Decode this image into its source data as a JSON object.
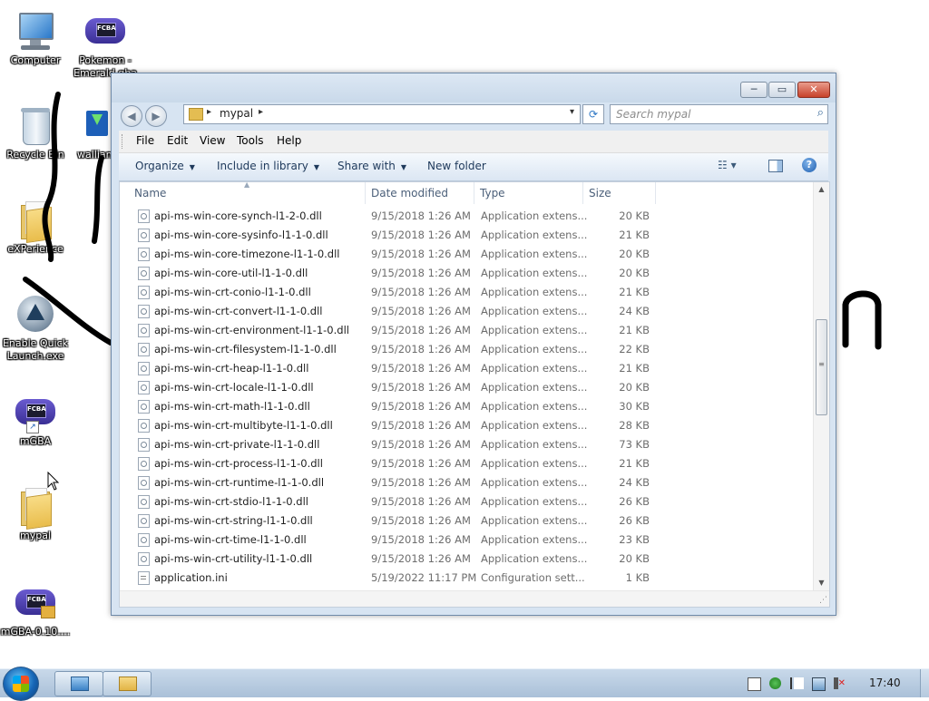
{
  "desktop": {
    "icons": [
      {
        "label": "Computer",
        "icon": "computer-icon"
      },
      {
        "label": "Pokemon - Emerald.gba",
        "icon": "gba-icon"
      },
      {
        "label": "Recycle Bin",
        "icon": "recycle-bin-icon"
      },
      {
        "label": "wallian",
        "icon": "installer-icon"
      },
      {
        "label": "eXPerience",
        "icon": "folder-icon"
      },
      {
        "label": "Enable Quick Launch.exe",
        "icon": "quick-launch-icon"
      },
      {
        "label": "mGBA",
        "icon": "gba-icon"
      },
      {
        "label": "mypal",
        "icon": "folder-icon"
      },
      {
        "label": "mGBA-0.10....",
        "icon": "gba-icon"
      }
    ],
    "gba_badge": "FCBA"
  },
  "window": {
    "controls": {
      "minimize": "─",
      "maximize": "▭",
      "close": "✕"
    },
    "nav": {
      "back": "◀",
      "forward": "▶"
    },
    "address": {
      "breadcrumb": "mypal",
      "separator": "▸",
      "dropdown": "▾"
    },
    "refresh_glyph": "⟳",
    "search": {
      "placeholder": "Search mypal",
      "glyph": "⌕"
    },
    "menu": [
      "File",
      "Edit",
      "View",
      "Tools",
      "Help"
    ],
    "commands": {
      "organize": "Organize",
      "include_in_library": "Include in library",
      "share_with": "Share with",
      "new_folder": "New folder",
      "dropdown_arrow": "▼",
      "views_glyph": "☷ ▾",
      "help_glyph": "?"
    },
    "columns": {
      "name": "Name",
      "date": "Date modified",
      "type": "Type",
      "size": "Size",
      "sort_glyph": "▲"
    },
    "scroll": {
      "up": "▲",
      "down": "▼",
      "grip": "≡"
    },
    "resize_glyph": "⋰",
    "files": [
      {
        "name": "api-ms-win-core-synch-l1-2-0.dll",
        "date": "9/15/2018 1:26 AM",
        "type": "Application extens...",
        "size": "20 KB",
        "kind": "dll"
      },
      {
        "name": "api-ms-win-core-sysinfo-l1-1-0.dll",
        "date": "9/15/2018 1:26 AM",
        "type": "Application extens...",
        "size": "21 KB",
        "kind": "dll"
      },
      {
        "name": "api-ms-win-core-timezone-l1-1-0.dll",
        "date": "9/15/2018 1:26 AM",
        "type": "Application extens...",
        "size": "20 KB",
        "kind": "dll"
      },
      {
        "name": "api-ms-win-core-util-l1-1-0.dll",
        "date": "9/15/2018 1:26 AM",
        "type": "Application extens...",
        "size": "20 KB",
        "kind": "dll"
      },
      {
        "name": "api-ms-win-crt-conio-l1-1-0.dll",
        "date": "9/15/2018 1:26 AM",
        "type": "Application extens...",
        "size": "21 KB",
        "kind": "dll"
      },
      {
        "name": "api-ms-win-crt-convert-l1-1-0.dll",
        "date": "9/15/2018 1:26 AM",
        "type": "Application extens...",
        "size": "24 KB",
        "kind": "dll"
      },
      {
        "name": "api-ms-win-crt-environment-l1-1-0.dll",
        "date": "9/15/2018 1:26 AM",
        "type": "Application extens...",
        "size": "21 KB",
        "kind": "dll"
      },
      {
        "name": "api-ms-win-crt-filesystem-l1-1-0.dll",
        "date": "9/15/2018 1:26 AM",
        "type": "Application extens...",
        "size": "22 KB",
        "kind": "dll"
      },
      {
        "name": "api-ms-win-crt-heap-l1-1-0.dll",
        "date": "9/15/2018 1:26 AM",
        "type": "Application extens...",
        "size": "21 KB",
        "kind": "dll"
      },
      {
        "name": "api-ms-win-crt-locale-l1-1-0.dll",
        "date": "9/15/2018 1:26 AM",
        "type": "Application extens...",
        "size": "20 KB",
        "kind": "dll"
      },
      {
        "name": "api-ms-win-crt-math-l1-1-0.dll",
        "date": "9/15/2018 1:26 AM",
        "type": "Application extens...",
        "size": "30 KB",
        "kind": "dll"
      },
      {
        "name": "api-ms-win-crt-multibyte-l1-1-0.dll",
        "date": "9/15/2018 1:26 AM",
        "type": "Application extens...",
        "size": "28 KB",
        "kind": "dll"
      },
      {
        "name": "api-ms-win-crt-private-l1-1-0.dll",
        "date": "9/15/2018 1:26 AM",
        "type": "Application extens...",
        "size": "73 KB",
        "kind": "dll"
      },
      {
        "name": "api-ms-win-crt-process-l1-1-0.dll",
        "date": "9/15/2018 1:26 AM",
        "type": "Application extens...",
        "size": "21 KB",
        "kind": "dll"
      },
      {
        "name": "api-ms-win-crt-runtime-l1-1-0.dll",
        "date": "9/15/2018 1:26 AM",
        "type": "Application extens...",
        "size": "24 KB",
        "kind": "dll"
      },
      {
        "name": "api-ms-win-crt-stdio-l1-1-0.dll",
        "date": "9/15/2018 1:26 AM",
        "type": "Application extens...",
        "size": "26 KB",
        "kind": "dll"
      },
      {
        "name": "api-ms-win-crt-string-l1-1-0.dll",
        "date": "9/15/2018 1:26 AM",
        "type": "Application extens...",
        "size": "26 KB",
        "kind": "dll"
      },
      {
        "name": "api-ms-win-crt-time-l1-1-0.dll",
        "date": "9/15/2018 1:26 AM",
        "type": "Application extens...",
        "size": "23 KB",
        "kind": "dll"
      },
      {
        "name": "api-ms-win-crt-utility-l1-1-0.dll",
        "date": "9/15/2018 1:26 AM",
        "type": "Application extens...",
        "size": "20 KB",
        "kind": "dll"
      },
      {
        "name": "application.ini",
        "date": "5/19/2022 11:17 PM",
        "type": "Configuration sett...",
        "size": "1 KB",
        "kind": "ini"
      }
    ]
  },
  "taskbar": {
    "clock": "17:40",
    "pinned": [
      {
        "name": "control-panel-icon"
      },
      {
        "name": "explorer-icon"
      }
    ],
    "tray": [
      "document-icon",
      "security-icon",
      "action-center-flag-icon",
      "network-icon",
      "volume-muted-icon"
    ]
  },
  "colors": {
    "selection_blue": "#3399ff",
    "folder_yellow": "#e9bd4c",
    "window_frame": "#d7e4f2"
  }
}
